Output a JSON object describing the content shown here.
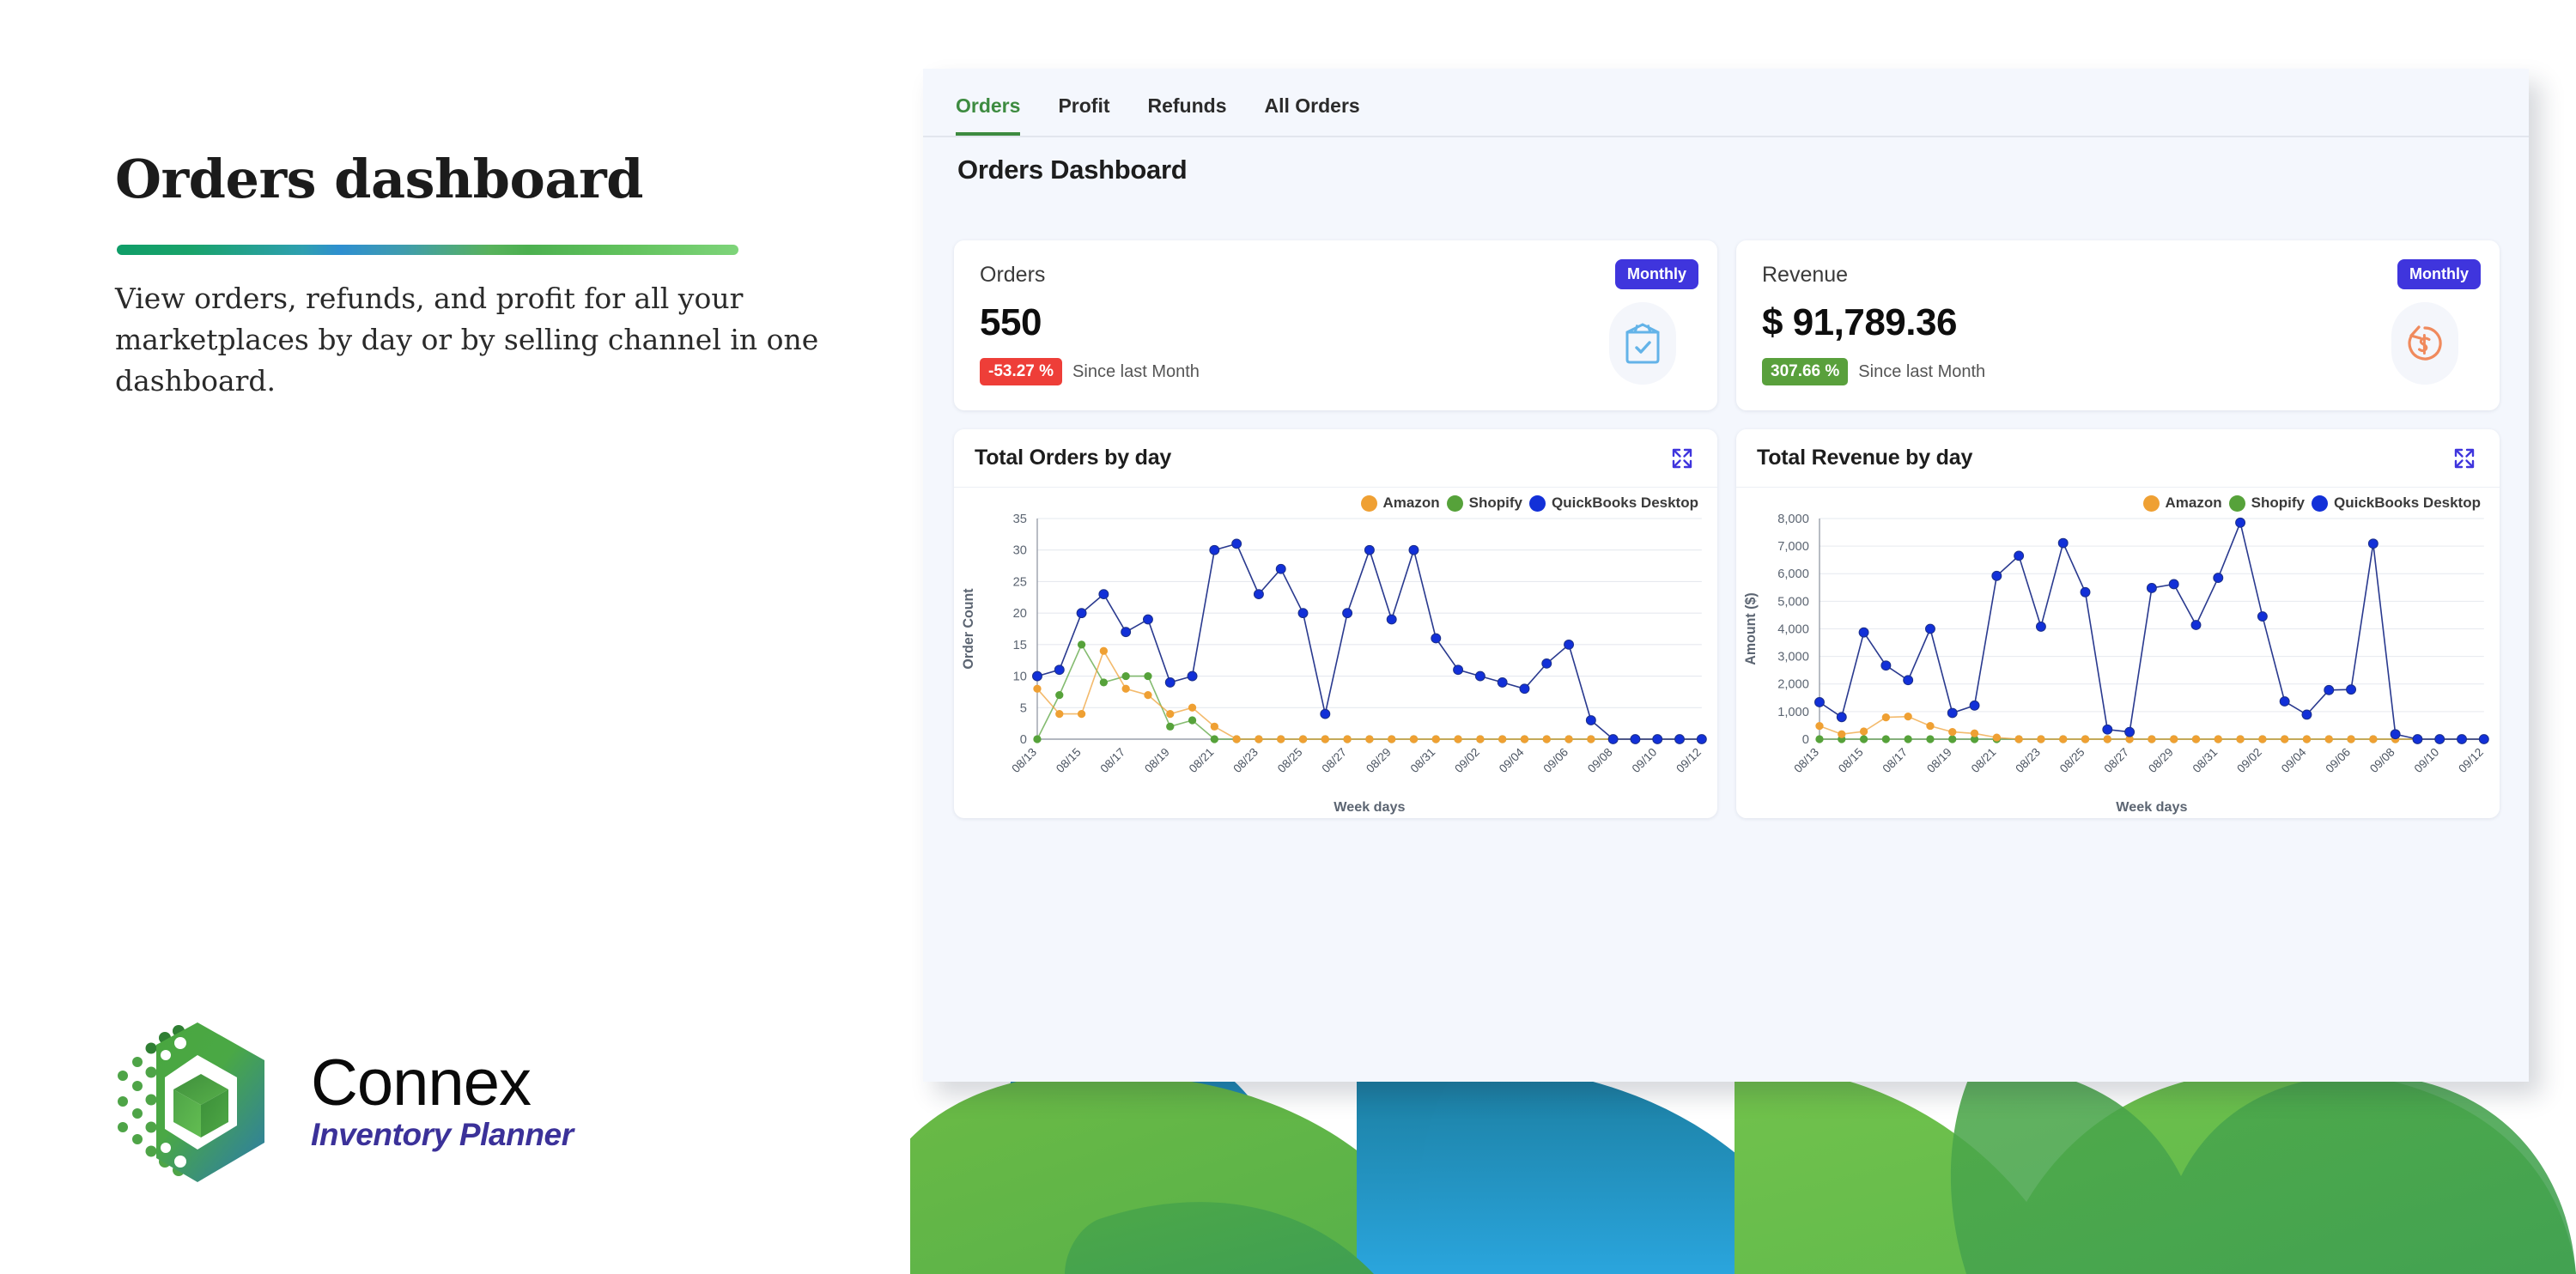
{
  "hero": {
    "headline": "Orders dashboard",
    "subcopy": "View orders, refunds, and profit for all your marketplaces by day or by selling channel in one dashboard."
  },
  "logo": {
    "name": "Connex",
    "tagline": "Inventory Planner"
  },
  "app": {
    "tabs": [
      {
        "label": "Orders",
        "active": true
      },
      {
        "label": "Profit",
        "active": false
      },
      {
        "label": "Refunds",
        "active": false
      },
      {
        "label": "All Orders",
        "active": false
      }
    ],
    "page_title": "Orders Dashboard",
    "active_tab_color": "#3d8b40"
  },
  "kpis": [
    {
      "label": "Orders",
      "value": "550",
      "badge": "-53.27 %",
      "badge_color": "#ee3e38",
      "since": "Since last Month",
      "chip": "Monthly",
      "icon": "package-check-icon",
      "icon_color": "#63b3e8"
    },
    {
      "label": "Revenue",
      "value": "$ 91,789.36",
      "badge": "307.66 %",
      "badge_color": "#59a03c",
      "since": "Since last Month",
      "chip": "Monthly",
      "icon": "refund-dollar-icon",
      "icon_color": "#f08a5d"
    }
  ],
  "charts": [
    {
      "title": "Total Orders by day",
      "expand_icon": "expand-icon"
    },
    {
      "title": "Total Revenue by day",
      "expand_icon": "expand-icon"
    }
  ],
  "legend": [
    {
      "name": "Amazon",
      "color": "#efa033"
    },
    {
      "name": "Shopify",
      "color": "#56a23a"
    },
    {
      "name": "QuickBooks Desktop",
      "color": "#1230d8"
    }
  ],
  "chart_data": [
    {
      "type": "line",
      "title": "Total Orders by day",
      "xlabel": "Week days",
      "ylabel": "Order Count",
      "ylim": [
        0,
        35
      ],
      "yticks": [
        0,
        5,
        10,
        15,
        20,
        25,
        30,
        35
      ],
      "grid": true,
      "legend_position": "top-right",
      "x": [
        "08/13",
        "08/14",
        "08/15",
        "08/16",
        "08/17",
        "08/18",
        "08/19",
        "08/20",
        "08/21",
        "08/22",
        "08/23",
        "08/24",
        "08/25",
        "08/26",
        "08/27",
        "08/28",
        "08/29",
        "08/30",
        "08/31",
        "09/01",
        "09/02",
        "09/03",
        "09/04",
        "09/05",
        "09/06",
        "09/07",
        "09/08",
        "09/09",
        "09/10",
        "09/11",
        "09/12"
      ],
      "xtick_labels": [
        "08/13",
        "08/15",
        "08/17",
        "08/19",
        "08/21",
        "08/23",
        "08/25",
        "08/27",
        "08/29",
        "08/31",
        "09/02",
        "09/04",
        "09/06",
        "09/08",
        "09/10",
        "09/12"
      ],
      "series": [
        {
          "name": "Amazon",
          "color": "#efa033",
          "values": [
            8,
            4,
            4,
            14,
            8,
            7,
            4,
            5,
            2,
            0,
            0,
            0,
            0,
            0,
            0,
            0,
            0,
            0,
            0,
            0,
            0,
            0,
            0,
            0,
            0,
            0,
            0,
            0,
            0,
            0,
            0
          ]
        },
        {
          "name": "Shopify",
          "color": "#56a23a",
          "values": [
            0,
            7,
            15,
            9,
            10,
            10,
            2,
            3,
            0,
            0,
            0,
            0,
            0,
            0,
            0,
            0,
            0,
            0,
            0,
            0,
            0,
            0,
            0,
            0,
            0,
            0,
            0,
            0,
            0,
            0,
            0
          ]
        },
        {
          "name": "QuickBooks Desktop",
          "color": "#1230d8",
          "values": [
            10,
            11,
            20,
            23,
            17,
            19,
            9,
            10,
            30,
            31,
            23,
            27,
            20,
            4,
            20,
            30,
            19,
            30,
            16,
            11,
            10,
            9,
            8,
            12,
            15,
            3,
            0,
            0,
            0,
            0,
            0
          ]
        }
      ]
    },
    {
      "type": "line",
      "title": "Total Revenue by day",
      "xlabel": "Week days",
      "ylabel": "Amount ($)",
      "ylim": [
        0,
        8000
      ],
      "yticks": [
        0,
        1000,
        2000,
        3000,
        4000,
        5000,
        6000,
        7000,
        8000
      ],
      "grid": true,
      "legend_position": "top-right",
      "x": [
        "08/13",
        "08/14",
        "08/15",
        "08/16",
        "08/17",
        "08/18",
        "08/19",
        "08/20",
        "08/21",
        "08/22",
        "08/23",
        "08/24",
        "08/25",
        "08/26",
        "08/27",
        "08/28",
        "08/29",
        "08/30",
        "08/31",
        "09/01",
        "09/02",
        "09/03",
        "09/04",
        "09/05",
        "09/06",
        "09/07",
        "09/08",
        "09/09",
        "09/10",
        "09/11",
        "09/12"
      ],
      "xtick_labels": [
        "08/13",
        "08/15",
        "08/17",
        "08/19",
        "08/21",
        "08/23",
        "08/25",
        "08/27",
        "08/29",
        "08/31",
        "09/02",
        "09/04",
        "09/06",
        "09/08",
        "09/10",
        "09/12"
      ],
      "series": [
        {
          "name": "Amazon",
          "color": "#efa033",
          "values": [
            480,
            180,
            280,
            790,
            820,
            480,
            260,
            210,
            60,
            0,
            0,
            0,
            0,
            0,
            0,
            0,
            0,
            0,
            0,
            0,
            0,
            0,
            0,
            0,
            0,
            0,
            0,
            0,
            0,
            0,
            0
          ]
        },
        {
          "name": "Shopify",
          "color": "#56a23a",
          "values": [
            0,
            0,
            0,
            0,
            0,
            0,
            0,
            0,
            0,
            0,
            0,
            0,
            0,
            0,
            0,
            0,
            0,
            0,
            0,
            0,
            0,
            0,
            0,
            0,
            0,
            0,
            0,
            0,
            0,
            0,
            0
          ]
        },
        {
          "name": "QuickBooks Desktop",
          "color": "#1230d8",
          "values": [
            1340,
            800,
            3870,
            2670,
            2140,
            4000,
            950,
            1220,
            5920,
            6650,
            4080,
            7110,
            5330,
            350,
            260,
            5480,
            5620,
            4140,
            5850,
            7850,
            4450,
            1370,
            890,
            1780,
            1800,
            7090,
            180,
            0,
            0,
            0,
            0
          ]
        }
      ]
    }
  ]
}
